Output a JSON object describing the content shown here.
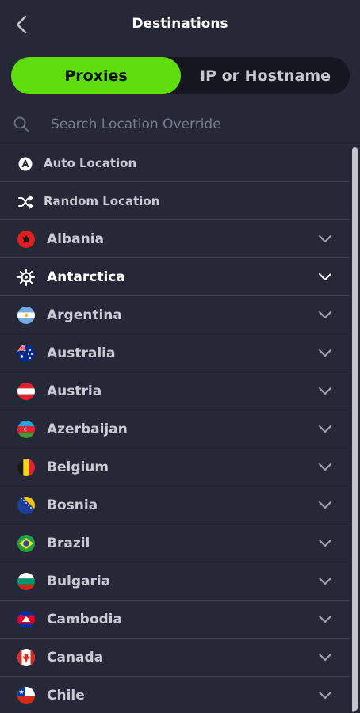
{
  "header": {
    "title": "Destinations"
  },
  "tabs": {
    "active": "Proxies",
    "inactive": "IP or Hostname"
  },
  "search": {
    "placeholder": "Search Location Override"
  },
  "special_items": [
    {
      "label": "Auto Location",
      "icon": "auto-location-icon"
    },
    {
      "label": "Random Location",
      "icon": "shuffle-icon"
    }
  ],
  "countries": [
    {
      "label": "Albania",
      "flag": "albania-flag-icon"
    },
    {
      "label": "Antarctica",
      "flag": "antarctica-flag-icon",
      "selected": true
    },
    {
      "label": "Argentina",
      "flag": "argentina-flag-icon"
    },
    {
      "label": "Australia",
      "flag": "australia-flag-icon"
    },
    {
      "label": "Austria",
      "flag": "austria-flag-icon"
    },
    {
      "label": "Azerbaijan",
      "flag": "azerbaijan-flag-icon"
    },
    {
      "label": "Belgium",
      "flag": "belgium-flag-icon"
    },
    {
      "label": "Bosnia",
      "flag": "bosnia-flag-icon"
    },
    {
      "label": "Brazil",
      "flag": "brazil-flag-icon"
    },
    {
      "label": "Bulgaria",
      "flag": "bulgaria-flag-icon"
    },
    {
      "label": "Cambodia",
      "flag": "cambodia-flag-icon"
    },
    {
      "label": "Canada",
      "flag": "canada-flag-icon"
    },
    {
      "label": "Chile",
      "flag": "chile-flag-icon"
    }
  ],
  "colors": {
    "accent": "#5ddc0e",
    "background": "#262837",
    "divider": "#3b3e4f"
  }
}
